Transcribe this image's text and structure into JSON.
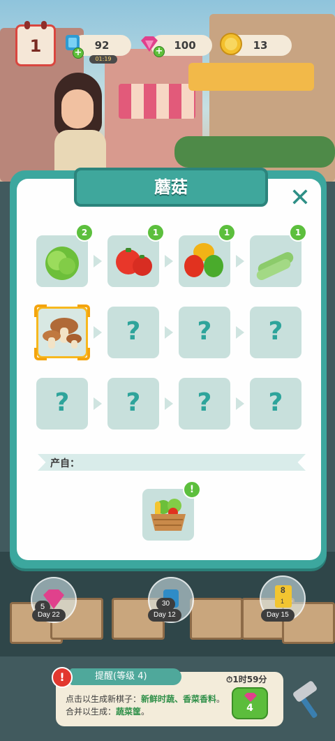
{
  "hud": {
    "level": "1",
    "energy": {
      "value": "92",
      "timer": "01:19",
      "icon": "energy-bolt-icon"
    },
    "gems": {
      "value": "100",
      "icon": "gem-icon"
    },
    "coins": {
      "value": "13",
      "icon": "coin-icon"
    }
  },
  "modal": {
    "title": "蘑菇",
    "close_icon": "close-icon",
    "items": [
      {
        "icon": "lettuce-icon",
        "badge": "2",
        "unlocked": true
      },
      {
        "icon": "tomato-icon",
        "badge": "1",
        "unlocked": true
      },
      {
        "icon": "bell-pepper-icon",
        "badge": "1",
        "unlocked": true
      },
      {
        "icon": "cucumber-icon",
        "badge": "1",
        "unlocked": true
      },
      {
        "icon": "mushroom-icon",
        "unlocked": true,
        "selected": true
      },
      {
        "label": "?",
        "unlocked": false
      },
      {
        "label": "?",
        "unlocked": false
      },
      {
        "label": "?",
        "unlocked": false
      },
      {
        "label": "?",
        "unlocked": false
      },
      {
        "label": "?",
        "unlocked": false
      },
      {
        "label": "?",
        "unlocked": false
      },
      {
        "label": "?",
        "unlocked": false
      }
    ],
    "source_label": "产自：",
    "source_item": {
      "icon": "vegetable-basket-icon",
      "badge": "!"
    }
  },
  "board": {
    "crates": [
      {
        "reward_icon": "gem-icon",
        "count": "5",
        "day": "Day 22"
      },
      {
        "reward_icon": "energy-bolt-icon",
        "count": "30",
        "day": "Day 12"
      },
      {
        "reward_icon": "card-icon",
        "count": "8",
        "sub": "1",
        "day": "Day 15"
      }
    ]
  },
  "quest": {
    "alert": "!",
    "title": "提醒(等级 4)",
    "timer": "1时59分",
    "text_prefix": "点击以生成新棋子：",
    "highlight1": "新鲜时蔬、香菜香料",
    "text_mid": "。合并以生成：",
    "highlight2": "蔬菜筐",
    "text_end": "。",
    "button_value": "4",
    "button_icon": "gem-icon",
    "tool_icon": "hammer-icon"
  },
  "colors": {
    "teal": "#3ca79e",
    "tile": "#c8e0dc",
    "question": "#2ea49b",
    "badge_green": "#5cbf3d",
    "selected_border": "#f4a40e"
  }
}
